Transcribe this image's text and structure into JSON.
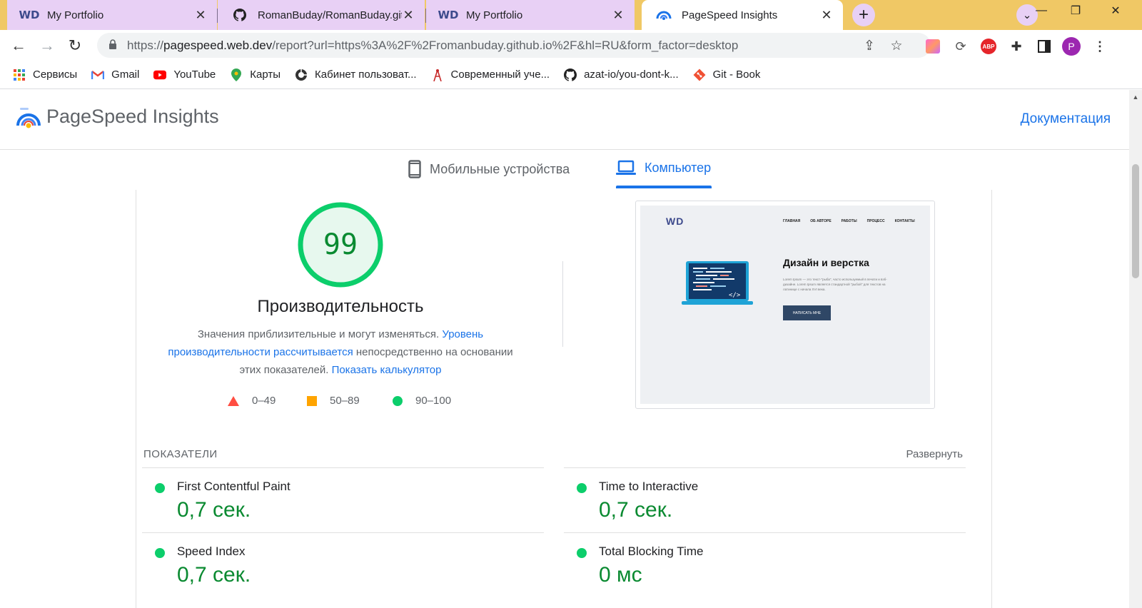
{
  "browser": {
    "tabs": [
      {
        "title": "My Portfolio",
        "favicon": "wd-logo-icon"
      },
      {
        "title": "RomanBuday/RomanBuday.githu",
        "favicon": "github-icon"
      },
      {
        "title": "My Portfolio",
        "favicon": "wd-logo-icon"
      },
      {
        "title": "PageSpeed Insights",
        "favicon": "pagespeed-icon"
      }
    ],
    "favicon_text": "WD",
    "tab_close": "✕",
    "new_tab": "+",
    "window": {
      "minimize": "—",
      "maximize": "❐",
      "close": "✕"
    },
    "url": {
      "scheme": "https://",
      "host": "pagespeed.web.dev",
      "path": "/report?url=https%3A%2F%2Fromanbuday.github.io%2F&hl=RU&form_factor=desktop"
    },
    "profile_initial": "P",
    "bookmarks": [
      {
        "label": "Сервисы",
        "icon": "apps-grid-icon"
      },
      {
        "label": "Gmail",
        "icon": "gmail-icon"
      },
      {
        "label": "YouTube",
        "icon": "youtube-icon"
      },
      {
        "label": "Карты",
        "icon": "maps-pin-icon"
      },
      {
        "label": "Кабинет пользоват...",
        "icon": "globe-icon"
      },
      {
        "label": "Современный уче...",
        "icon": "antenna-icon"
      },
      {
        "label": "azat-io/you-dont-k...",
        "icon": "github-icon"
      },
      {
        "label": "Git - Book",
        "icon": "git-icon"
      }
    ]
  },
  "psi": {
    "brand": "PageSpeed Insights",
    "docs_link": "Документация",
    "form_tabs": {
      "mobile": "Мобильные устройства",
      "desktop": "Компьютер"
    },
    "score": 99,
    "score_title": "Производительность",
    "desc": {
      "part1": "Значения приблизительные и могут изменяться. ",
      "link1": "Уровень производительности рассчитывается",
      "part2": " непосредственно на основании этих показателей. ",
      "link2": "Показать калькулятор"
    },
    "legend": [
      {
        "range": "0–49",
        "color": "#ff4e42"
      },
      {
        "range": "50–89",
        "color": "#ffa400"
      },
      {
        "range": "90–100",
        "color": "#0cce6b"
      }
    ],
    "screenshot": {
      "logo": "WD",
      "nav": [
        "ГЛАВНАЯ",
        "ОБ АВТОРЕ",
        "РАБОТЫ",
        "ПРОЦЕСС",
        "КОНТАКТЫ"
      ],
      "heading": "Дизайн и верстка",
      "text": "Lorem Ipsum — это текст-\"рыба\", часто используемый в печати и вэб-дизайне. Lorem Ipsum является стандартной \"рыбой\" для текстов на латинице с начала XVI века.",
      "button": "НАПИСАТЬ МНЕ"
    },
    "metrics_title": "ПОКАЗАТЕЛИ",
    "expand": "Развернуть",
    "metrics": [
      {
        "label": "First Contentful Paint",
        "value": "0,7 сек."
      },
      {
        "label": "Time to Interactive",
        "value": "0,7 сек."
      },
      {
        "label": "Speed Index",
        "value": "0,7 сек."
      },
      {
        "label": "Total Blocking Time",
        "value": "0 мс"
      }
    ]
  },
  "colors": {
    "accent": "#1a73e8",
    "good": "#0cce6b",
    "good_text": "#0a8a31"
  }
}
